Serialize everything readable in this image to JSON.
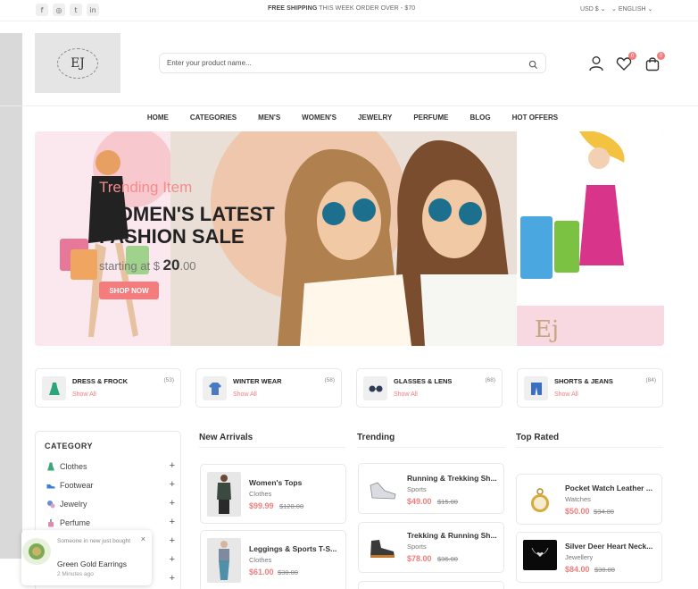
{
  "topbar": {
    "social": [
      "facebook-icon",
      "instagram-icon",
      "twitter-icon",
      "linkedin-icon"
    ],
    "shipping_bold": "FREE SHIPPING",
    "shipping_rest": " THIS WEEK ORDER OVER - $70",
    "currency": "USD $",
    "language": "ENGLISH"
  },
  "header": {
    "logo_text": "EJ",
    "search_placeholder": "Enter your product name...",
    "wishlist_count": "0",
    "cart_count": "0"
  },
  "nav": [
    "HOME",
    "CATEGORIES",
    "MEN'S",
    "WOMEN'S",
    "JEWELRY",
    "PERFUME",
    "BLOG",
    "HOT OFFERS"
  ],
  "hero": {
    "subtitle": "Trending Item",
    "title_line1": "WOMEN'S LATEST",
    "title_line2": "FASHION SALE",
    "price_prefix": "starting at $ ",
    "price_whole": "20",
    "price_cents": ".00",
    "button": "SHOP NOW"
  },
  "categories": [
    {
      "name": "DRESS & FROCK",
      "count": "(53)",
      "link": "Show All",
      "icon": "dress-icon"
    },
    {
      "name": "WINTER WEAR",
      "count": "(58)",
      "link": "Show All",
      "icon": "coat-icon"
    },
    {
      "name": "GLASSES & LENS",
      "count": "(68)",
      "link": "Show All",
      "icon": "glasses-icon"
    },
    {
      "name": "SHORTS & JEANS",
      "count": "(84)",
      "link": "Show All",
      "icon": "shorts-icon"
    }
  ],
  "sidebar": {
    "title": "CATEGORY",
    "items": [
      {
        "label": "Clothes",
        "icon": "dress-icon",
        "color": "#3aa87a"
      },
      {
        "label": "Footwear",
        "icon": "shoe-icon",
        "color": "#3a7fd5"
      },
      {
        "label": "Jewelry",
        "icon": "jewelry-icon",
        "color": "#6a8fd8"
      },
      {
        "label": "Perfume",
        "icon": "perfume-icon",
        "color": "#e08aa8"
      },
      {
        "label": "",
        "icon": "",
        "color": ""
      },
      {
        "label": "",
        "icon": "",
        "color": ""
      },
      {
        "label": "",
        "icon": "",
        "color": ""
      }
    ],
    "plus": "+"
  },
  "toast": {
    "message": "Someone in new just bought",
    "title": "Green Gold Earrings",
    "time": "2 Minutes ago",
    "close": "×"
  },
  "columns": {
    "new_arrivals": {
      "title": "New Arrivals",
      "products": [
        {
          "name": "Women's Tops",
          "category": "Clothes",
          "price": "$99.99",
          "old_price": "$120.00"
        },
        {
          "name": "Leggings & Sports T-S...",
          "category": "Clothes",
          "price": "$61.00",
          "old_price": "$30.00"
        }
      ]
    },
    "trending": {
      "title": "Trending",
      "products": [
        {
          "name": "Running & Trekking Sh...",
          "category": "Sports",
          "price": "$49.00",
          "old_price": "$15.00"
        },
        {
          "name": "Trekking & Running Sh...",
          "category": "Sports",
          "price": "$78.00",
          "old_price": "$36.00"
        }
      ]
    },
    "top_rated": {
      "title": "Top Rated",
      "products": [
        {
          "name": "Pocket Watch Leather ...",
          "category": "Watches",
          "price": "$50.00",
          "old_price": "$34.00"
        },
        {
          "name": "Silver Deer Heart Neck...",
          "category": "Jewellery",
          "price": "$84.00",
          "old_price": "$30.00"
        }
      ]
    }
  },
  "colors": {
    "accent": "#f47c7c",
    "text": "#212121",
    "muted": "#888888",
    "border": "#e8e8e8"
  }
}
